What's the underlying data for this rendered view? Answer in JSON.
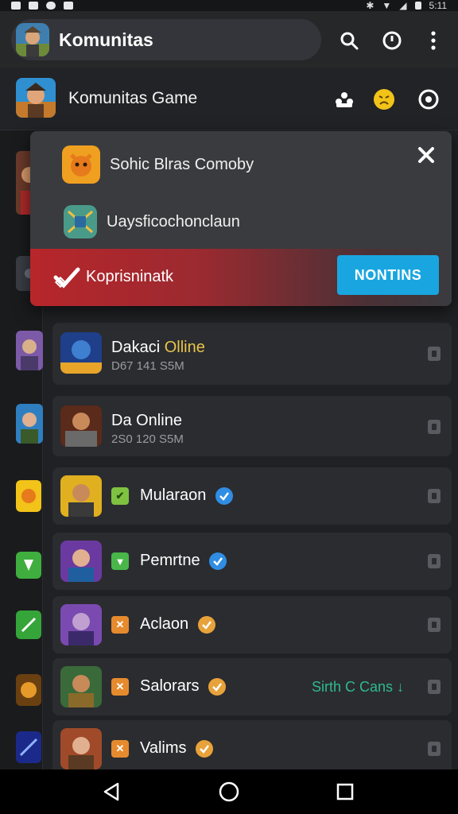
{
  "status_bar": {
    "time": "5:11"
  },
  "app_bar": {
    "title": "Komunitas",
    "accent": "#34353a"
  },
  "community": {
    "title": "Komunitas Game"
  },
  "popup": {
    "options": [
      {
        "label": "Sohic Blras  Comoby",
        "icon": "fox-icon"
      },
      {
        "label": "Uaysficochonclaun",
        "icon": "map-icon"
      }
    ],
    "banner_label": "Koprisninatk",
    "action_label": "NONTINS",
    "action_color": "#19a6e0"
  },
  "list": [
    {
      "name_a": "Dakaci ",
      "name_b": "Olline",
      "sub": "D67 141 S5M",
      "thumb": "dragon-icon"
    },
    {
      "name_a": "Da Online",
      "name_b": "",
      "sub": "2S0 120 S5M",
      "thumb": "warrior-icon"
    },
    {
      "name": "Mularaon",
      "tag": "✔",
      "tag_color": "#7fc241",
      "verified_color": "#2f8de4",
      "thumb": "hero-icon"
    },
    {
      "name": "Pemrtne",
      "tag": "▼",
      "tag_color": "#49b649",
      "verified_color": "#2f8de4",
      "thumb": "ranger-icon"
    },
    {
      "name": "Aclaon",
      "tag": "✕",
      "tag_color": "#e68a2e",
      "verified_color": "#e8a23a",
      "thumb": "wizard-icon"
    },
    {
      "name": "Salorars",
      "tag": "✕",
      "tag_color": "#e68a2e",
      "verified_color": "#e8a23a",
      "trailing": "Sirth C Cans ↓",
      "thumb": "archer-icon"
    },
    {
      "name": "Valims",
      "tag": "✕",
      "tag_color": "#e68a2e",
      "verified_color": "#e8a23a",
      "thumb": "knight-icon"
    }
  ]
}
